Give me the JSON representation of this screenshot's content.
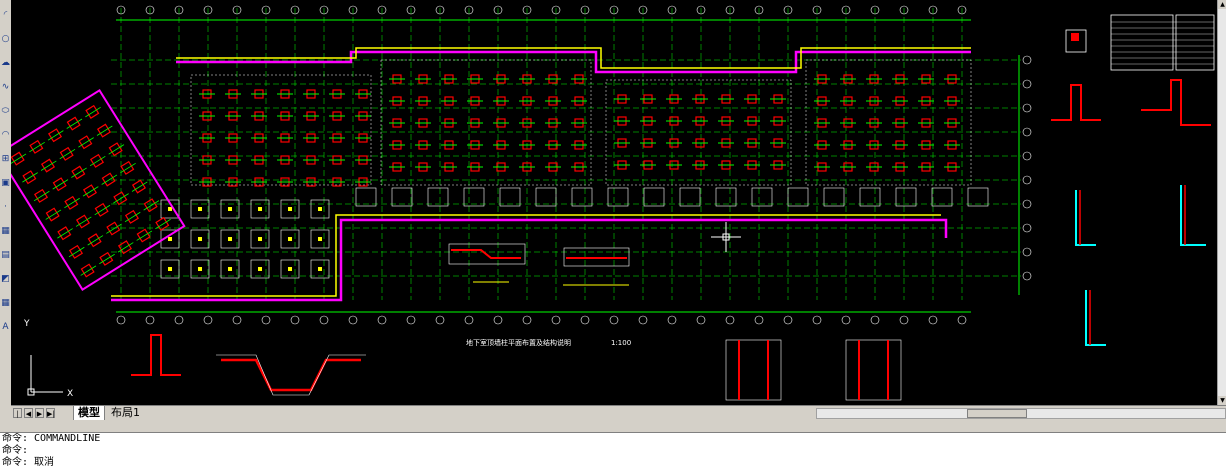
{
  "toolbar": {
    "icons": [
      "arc-icon",
      "circle-icon",
      "revcloud-icon",
      "spline-icon",
      "ellipse-icon",
      "ellipse-arc-icon",
      "insert-block-icon",
      "make-block-icon",
      "point-icon",
      "hatch-icon",
      "gradient-icon",
      "region-icon",
      "table-icon",
      "mtext-icon"
    ]
  },
  "canvas": {
    "background": "#000000",
    "colors": {
      "grid": "#00ff00",
      "wall": "#ffff00",
      "boundary": "#ff00ff",
      "rebar": "#ff0000",
      "axis": "#00ffff",
      "detail": "#ffffff"
    },
    "labels": {
      "plan_title": "地下室顶墙柱平面布置及结构说明",
      "plan_scale": "1:100",
      "ucs_y": "Y",
      "ucs_x": "X"
    }
  },
  "tabs": {
    "items": [
      {
        "label": "模型",
        "active": true
      },
      {
        "label": "布局1",
        "active": false
      }
    ]
  },
  "command": {
    "lines": [
      "命令: COMMANDLINE",
      "命令:",
      "命令: 取消"
    ]
  }
}
